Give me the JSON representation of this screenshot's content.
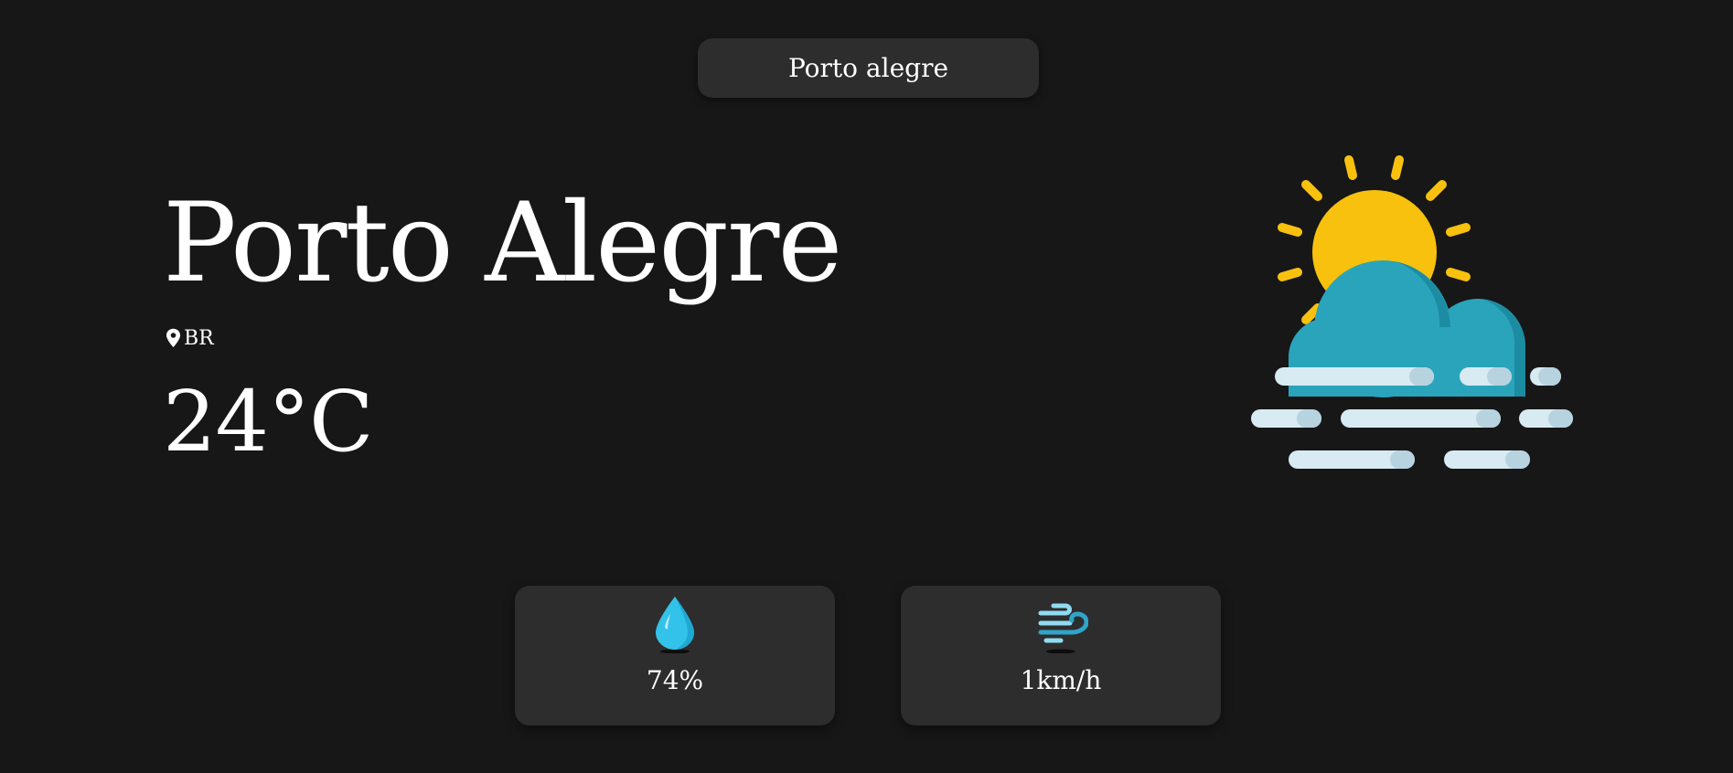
{
  "search": {
    "value": "Porto alegre"
  },
  "location": {
    "city": "Porto Alegre",
    "country": "BR"
  },
  "weather": {
    "temperature": "24°C",
    "condition_icon": "partly-cloudy-fog-icon"
  },
  "stats": {
    "humidity": {
      "icon": "water-drop-icon",
      "value": "74%"
    },
    "wind": {
      "icon": "wind-icon",
      "value": "1km/h"
    }
  },
  "colors": {
    "background": "#171717",
    "card": "#2d2d2d",
    "text": "#ffffff",
    "sun": "#f8c10d",
    "sun_shade": "#f49c22",
    "cloud": "#2aa4ba",
    "cloud_shade": "#1c8ca3",
    "fog": "#d8eaf2",
    "drop": "#33c3ea"
  }
}
